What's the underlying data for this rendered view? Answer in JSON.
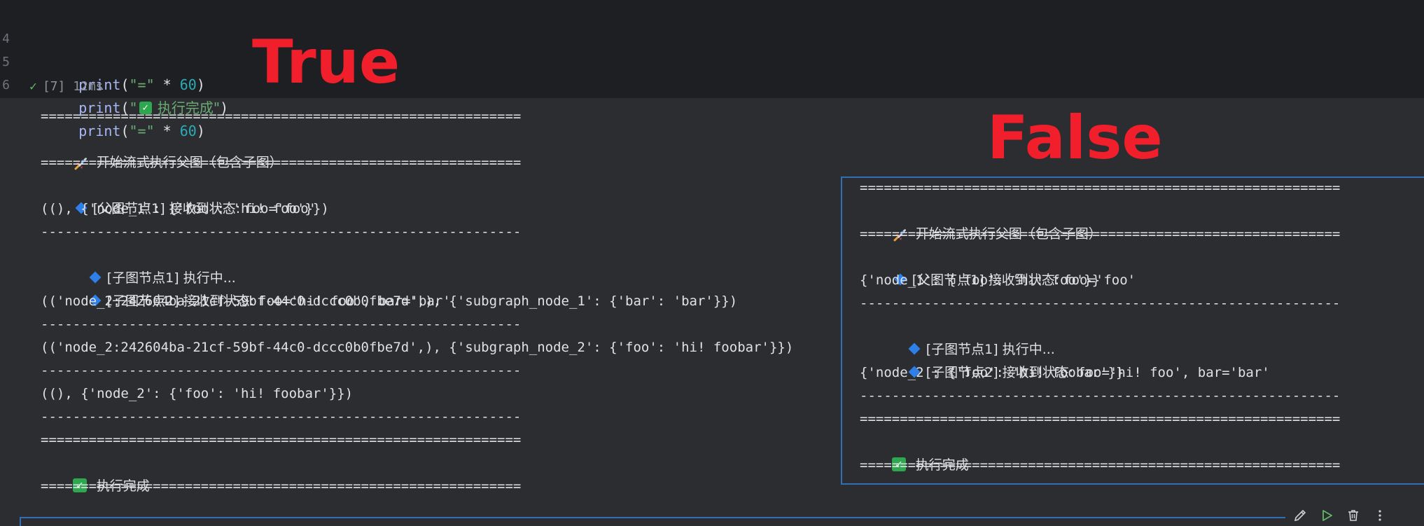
{
  "editor": {
    "lines": [
      {
        "num": "4",
        "fn": "print",
        "open": "(",
        "str": "\"=\"",
        "op": " * ",
        "num_val": "60",
        "close": ")"
      },
      {
        "num": "5",
        "fn": "print",
        "open": "(",
        "str_pre": "\"",
        "str_zh": " 执行完成\"",
        "close": ")"
      },
      {
        "num": "6",
        "fn": "print",
        "open": "(",
        "str": "\"=\"",
        "op": " * ",
        "num_val": "60",
        "close": ")"
      }
    ],
    "exec_status": "[7] 12ms"
  },
  "labels": {
    "true_label": "True",
    "false_label": "False"
  },
  "true_output": {
    "sep_eq": "============================================================",
    "sep_dash": "------------------------------------------------------------",
    "start_text": "开始流式执行父图（包含子图）",
    "parent_node_prefix": "[父图节点1] 接收到状态: ",
    "parent_node_value": "foo='foo'",
    "chunk1": "((), {'node_1': {'foo': 'hi! foo'}})",
    "sub_node1_prefix": "[子图节点1] 执行中...",
    "sub_node2_prefix": "[子图节点2] 接收到状态: ",
    "sub_node2_value": "foo='hi! foo', bar='bar'",
    "chunk2": "(('node_2:242604ba-21cf-59bf-44c0-dccc0b0fbe7d',), {'subgraph_node_1': {'bar': 'bar'}})",
    "chunk3": "(('node_2:242604ba-21cf-59bf-44c0-dccc0b0fbe7d',), {'subgraph_node_2': {'foo': 'hi! foobar'}})",
    "chunk4": "((), {'node_2': {'foo': 'hi! foobar'}})",
    "done_text": "执行完成"
  },
  "false_output": {
    "sep_eq": "============================================================",
    "sep_dash": "------------------------------------------------------------",
    "start_text": "开始流式执行父图（包含子图）",
    "parent_node_prefix": "[父图节点1] 接收到状态: ",
    "parent_node_value": "foo='foo'",
    "chunk1": "{'node_1': {'foo': 'hi! foo'}}",
    "sub_node1_prefix": "[子图节点1] 执行中...",
    "sub_node2_prefix": "[子图节点2] 接收到状态: ",
    "sub_node2_value": "foo='hi! foo', bar='bar'",
    "chunk2": "{'node_2': {'foo': 'hi! foobar'}}",
    "done_text": "执行完成"
  },
  "toolbar": {
    "icons": [
      "pencil-icon",
      "run-icon",
      "trash-icon",
      "more-icon"
    ],
    "colors": {
      "run": "#5fb865",
      "icon": "#ced0d6"
    }
  }
}
